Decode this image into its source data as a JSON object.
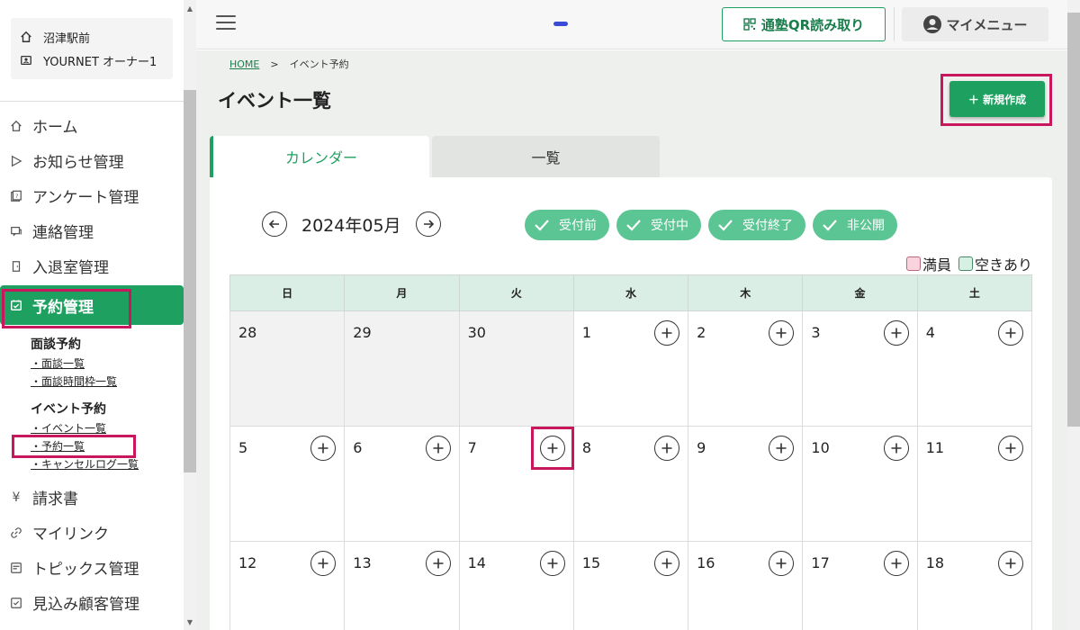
{
  "store": {
    "location": "沼津駅前",
    "owner": "YOURNET オーナー1"
  },
  "sidebar": {
    "items": [
      {
        "label": "ホーム",
        "icon": "home-icon"
      },
      {
        "label": "お知らせ管理",
        "icon": "send-icon"
      },
      {
        "label": "アンケート管理",
        "icon": "survey-icon"
      },
      {
        "label": "連絡管理",
        "icon": "message-icon"
      },
      {
        "label": "入退室管理",
        "icon": "door-icon"
      },
      {
        "label": "予約管理",
        "icon": "calendar-check-icon"
      },
      {
        "label": "請求書",
        "icon": "yen-icon"
      },
      {
        "label": "マイリンク",
        "icon": "link-icon"
      },
      {
        "label": "トピックス管理",
        "icon": "topics-icon"
      },
      {
        "label": "見込み顧客管理",
        "icon": "prospect-icon"
      }
    ],
    "sub_groups": [
      {
        "title": "面談予約",
        "links": [
          "・面談一覧",
          "・面談時間枠一覧"
        ]
      },
      {
        "title": "イベント予約",
        "links": [
          "・イベント一覧",
          "・予約一覧",
          "・キャンセルログ一覧"
        ]
      }
    ]
  },
  "header": {
    "qr_label": "通塾QR読み取り",
    "mymenu_label": "マイメニュー"
  },
  "breadcrumb": {
    "home": "HOME",
    "separator": ">",
    "current": "イベント予約"
  },
  "page": {
    "title": "イベント一覧",
    "new_button": "＋ 新規作成"
  },
  "tabs": {
    "calendar": "カレンダー",
    "list": "一覧"
  },
  "calendar": {
    "month": "2024年05月",
    "statuses": [
      "受付前",
      "受付中",
      "受付終了",
      "非公開"
    ],
    "legend": {
      "full": "満員",
      "available": "空きあり"
    },
    "weekdays": [
      "日",
      "月",
      "火",
      "水",
      "木",
      "金",
      "土"
    ],
    "weeks": [
      [
        "28",
        "29",
        "30",
        "1",
        "2",
        "3",
        "4"
      ],
      [
        "5",
        "6",
        "7",
        "8",
        "9",
        "10",
        "11"
      ],
      [
        "12",
        "13",
        "14",
        "15",
        "16",
        "17",
        "18"
      ]
    ],
    "other_month_days": [
      "28",
      "29",
      "30"
    ]
  },
  "colors": {
    "accent": "#1ea060",
    "highlight": "#c8175d",
    "chip": "#5cc594",
    "header_row": "#daeee5",
    "legend_full": "#f9d3dd",
    "legend_available": "#d6f0e3"
  }
}
